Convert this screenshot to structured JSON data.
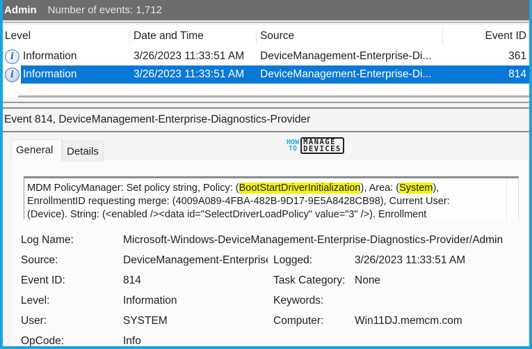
{
  "header": {
    "title": "Admin",
    "count_text": "Number of events: 1,712"
  },
  "table": {
    "columns": [
      "Level",
      "Date and Time",
      "Source",
      "Event ID"
    ],
    "rows": [
      {
        "level": "Information",
        "date": "3/26/2023 11:33:51 AM",
        "source": "DeviceManagement-Enterprise-Di...",
        "event_id": "361",
        "selected": false,
        "icon": "information-icon"
      },
      {
        "level": "Information",
        "date": "3/26/2023 11:33:51 AM",
        "source": "DeviceManagement-Enterprise-Di...",
        "event_id": "814",
        "selected": true,
        "icon": "information-icon"
      }
    ]
  },
  "details": {
    "title": "Event 814, DeviceManagement-Enterprise-Diagnostics-Provider",
    "tabs": [
      {
        "label": "General",
        "active": true
      },
      {
        "label": "Details",
        "active": false
      }
    ],
    "watermark": {
      "how": "HOW",
      "to": "TO",
      "line1": "MANAGE",
      "line2": "DEVICES"
    },
    "description": {
      "line1_pre": "MDM PolicyManager: Set policy string, Policy: (",
      "line1_hl1": "BootStartDriverInitialization",
      "line1_mid": "), Area: (",
      "line1_hl2": "System",
      "line1_post": "),",
      "line2": "EnrollmentID requesting merge: (4009A089-4FBA-482B-9D17-9E5A8428CB98), Current User:",
      "line3": "(Device). String: (<enabled /><data id=\"SelectDriverLoadPolicy\" value=\"3\" />). Enrollment"
    },
    "properties": {
      "log_name_label": "Log Name:",
      "log_name": "Microsoft-Windows-DeviceManagement-Enterprise-Diagnostics-Provider/Admin",
      "source_label": "Source:",
      "source": "DeviceManagement-Enterprise-Diagnostics-Provider",
      "logged_label": "Logged:",
      "logged": "3/26/2023 11:33:51 AM",
      "event_id_label": "Event ID:",
      "event_id": "814",
      "task_category_label": "Task Category:",
      "task_category": "None",
      "level_label": "Level:",
      "level": "Information",
      "keywords_label": "Keywords:",
      "keywords": "",
      "user_label": "User:",
      "user": "SYSTEM",
      "computer_label": "Computer:",
      "computer": "Win11DJ.memcm.com",
      "opcode_label": "OpCode:",
      "opcode": "Info"
    }
  },
  "colors": {
    "selection": "#0a78d7",
    "highlight": "#f4f214",
    "frame_border": "#1aa3e0",
    "header_bg": "#6d6d6d"
  }
}
